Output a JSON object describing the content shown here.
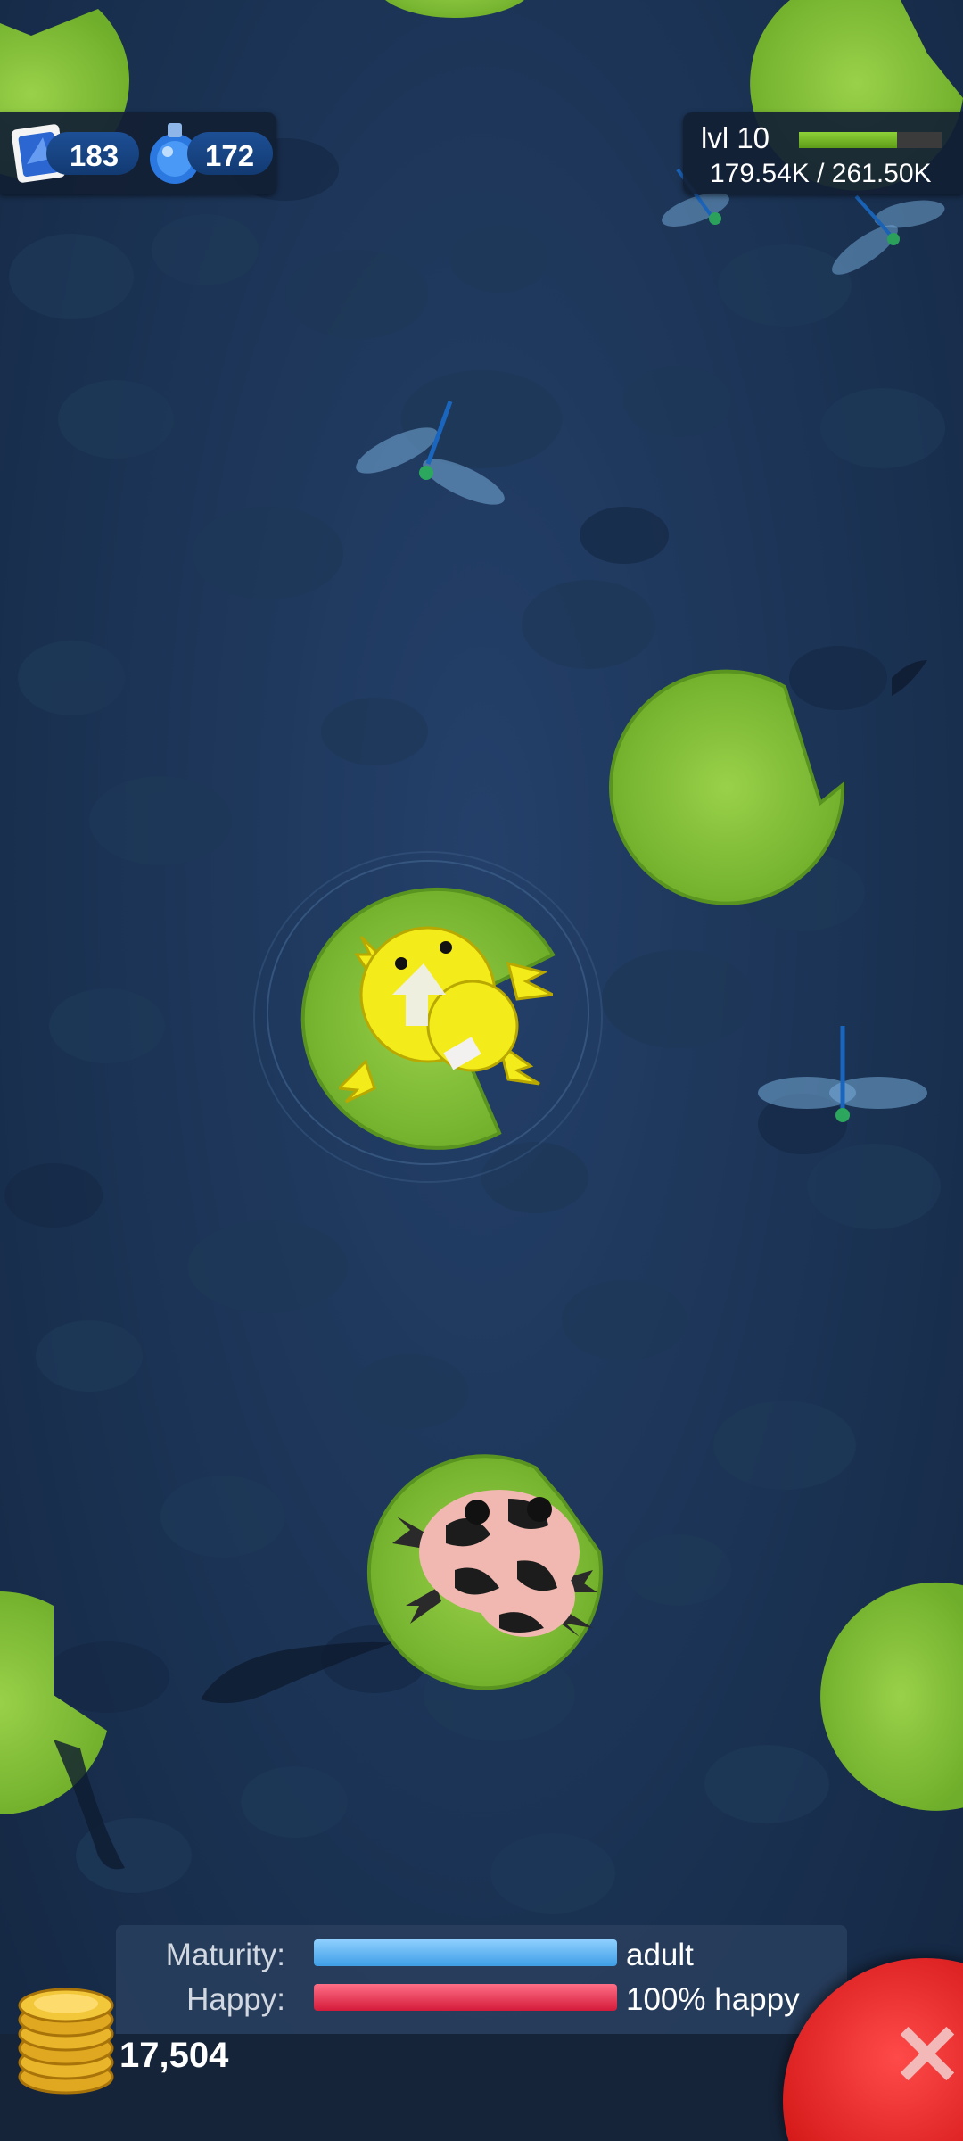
{
  "resources": {
    "stamps": "183",
    "potions": "172"
  },
  "level": {
    "label": "lvl 10",
    "xp_text": "179.54K / 261.50K",
    "progress_fraction": 0.686
  },
  "status": {
    "maturity_label": "Maturity:",
    "maturity_value": "adult",
    "maturity_fraction": 1.0,
    "happy_label": "Happy:",
    "happy_value": "100% happy",
    "happy_fraction": 1.0
  },
  "coins": {
    "amount": "17,504"
  },
  "colors": {
    "water": "#1b3354",
    "lily_pad": "#8ec63f",
    "maturity_bar": "#5fb4f0",
    "happy_bar": "#e8324e",
    "close_button": "#d41818"
  },
  "icons": {
    "stamp": "blue-stamp-icon",
    "potion": "blue-potion-icon",
    "coins": "gold-coins-icon",
    "close": "close-x-icon"
  }
}
